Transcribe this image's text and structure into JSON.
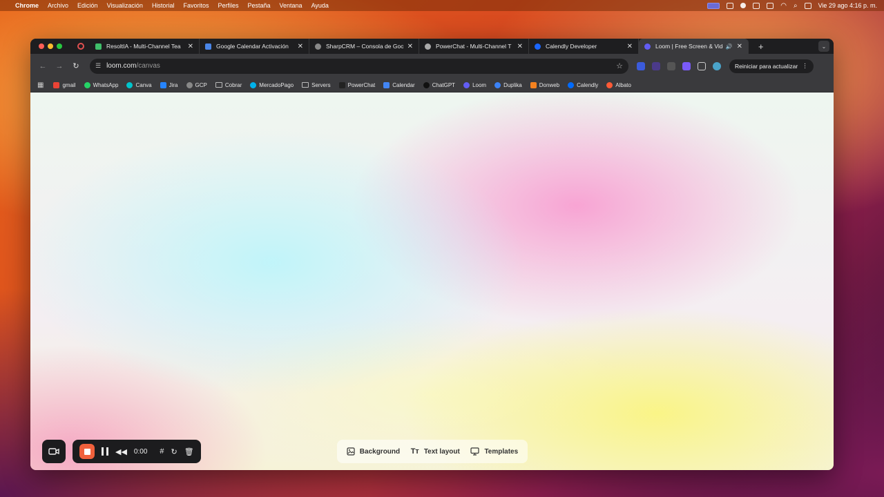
{
  "menubar": {
    "app": "Chrome",
    "items": [
      "Archivo",
      "Edición",
      "Visualización",
      "Historial",
      "Favoritos",
      "Perfiles",
      "Pestaña",
      "Ventana",
      "Ayuda"
    ],
    "clock": "Vie 29 ago  4:16 p. m."
  },
  "tabs": [
    {
      "title": "ResoltIA - Multi-Channel Tea",
      "color": "#3fbf6a"
    },
    {
      "title": "Google Calendar Activación",
      "color": "#4a86e8"
    },
    {
      "title": "SharpCRM – Consola de Goo",
      "color": "#888888"
    },
    {
      "title": "PowerChat - Multi-Channel T",
      "color": "#aaaaaa"
    },
    {
      "title": "Calendly Developer",
      "color": "#1a66ff"
    },
    {
      "title": "Loom | Free Screen & Vide",
      "color": "#625df5"
    }
  ],
  "address": {
    "host": "loom.com",
    "path": "/canvas"
  },
  "update_button": "Reiniciar para actualizar",
  "bookmarks": [
    {
      "label": "gmail",
      "color": "#ea4335"
    },
    {
      "label": "WhatsApp",
      "color": "#25d366"
    },
    {
      "label": "Canva",
      "color": "#00c4cc"
    },
    {
      "label": "Jira",
      "color": "#2684ff"
    },
    {
      "label": "GCP",
      "color": "#888888"
    },
    {
      "label": "Cobrar",
      "color": "folder"
    },
    {
      "label": "MercadoPago",
      "color": "#00b1ea"
    },
    {
      "label": "Servers",
      "color": "folder"
    },
    {
      "label": "PowerChat",
      "color": "#222222"
    },
    {
      "label": "Calendar",
      "color": "#4285f4"
    },
    {
      "label": "ChatGPT",
      "color": "#111111"
    },
    {
      "label": "Loom",
      "color": "#625df5"
    },
    {
      "label": "Duplika",
      "color": "#3b82f6"
    },
    {
      "label": "Donweb",
      "color": "#f5821f"
    },
    {
      "label": "Calendly",
      "color": "#006bff"
    },
    {
      "label": "Albato",
      "color": "#ff5a36"
    }
  ],
  "recorder": {
    "timer": "0:00"
  },
  "canvas_toolbar": {
    "background": "Background",
    "text_layout": "Text layout",
    "templates": "Templates"
  }
}
